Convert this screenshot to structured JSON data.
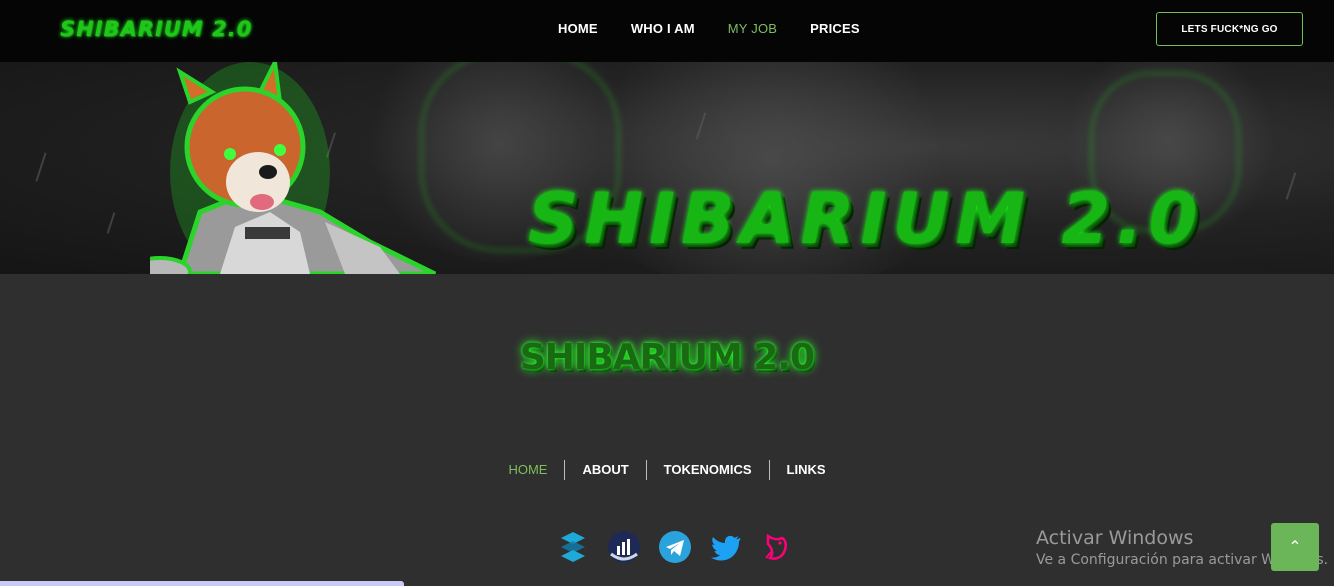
{
  "header": {
    "logo_text": "SHIBARIUM 2.0",
    "nav": [
      "HOME",
      "WHO I AM",
      "MY JOB",
      "PRICES"
    ],
    "active_nav": "MY JOB",
    "cta_label": "LETS FUCK*NG GO"
  },
  "banner": {
    "title": "SHIBARIUM 2.0"
  },
  "main": {
    "logo_text": "SHIBARIUM 2.0"
  },
  "footer": {
    "nav": [
      "HOME",
      "ABOUT",
      "TOKENOMICS",
      "LINKS"
    ],
    "active_nav": "HOME",
    "social_icons": [
      "dextools-icon",
      "dexscreener-icon",
      "telegram-icon",
      "twitter-icon",
      "uniswap-icon"
    ]
  },
  "windows_watermark": {
    "line1": "Activar Windows",
    "line2": "Ve a Configuración para activar Windows."
  },
  "colors": {
    "accent_green": "#7ebd5c",
    "neon_green": "#1aff1a",
    "background": "#2f2f2f",
    "topbar": "#050505"
  }
}
